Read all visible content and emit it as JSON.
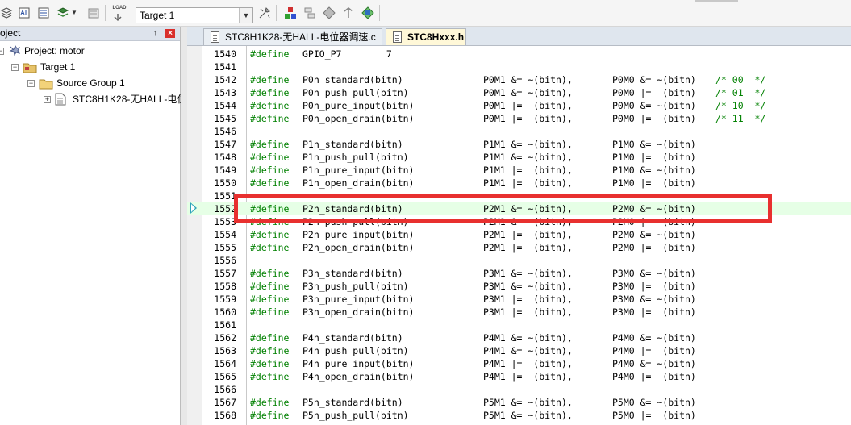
{
  "toolbar": {
    "target": "Target 1",
    "load_label": "LOAD"
  },
  "project_panel": {
    "title": "oject",
    "pin": "↑",
    "close": "×",
    "project": "Project: motor",
    "target": "Target 1",
    "group": "Source Group 1",
    "file": "STC8H1K28-无HALL-电位"
  },
  "tabs": [
    {
      "label": "STC8H1K28-无HALL-电位器调速.c",
      "active": false
    },
    {
      "label": "STC8Hxxx.h",
      "active": true
    }
  ],
  "editor": {
    "current_line": 1552,
    "lines": [
      {
        "n": "1540",
        "kw": "#define",
        "a": "GPIO_P7        7",
        "b": "",
        "c": "",
        "d": ""
      },
      {
        "n": "1541",
        "kw": "",
        "a": "",
        "b": "",
        "c": "",
        "d": ""
      },
      {
        "n": "1542",
        "kw": "#define",
        "a": "P0n_standard(bitn)",
        "b": "P0M1 &= ~(bitn),",
        "c": "P0M0 &= ~(bitn)",
        "d": "/* 00  */"
      },
      {
        "n": "1543",
        "kw": "#define",
        "a": "P0n_push_pull(bitn)",
        "b": "P0M1 &= ~(bitn),",
        "c": "P0M0 |=  (bitn)",
        "d": "/* 01  */"
      },
      {
        "n": "1544",
        "kw": "#define",
        "a": "P0n_pure_input(bitn)",
        "b": "P0M1 |=  (bitn),",
        "c": "P0M0 &= ~(bitn)",
        "d": "/* 10  */"
      },
      {
        "n": "1545",
        "kw": "#define",
        "a": "P0n_open_drain(bitn)",
        "b": "P0M1 |=  (bitn),",
        "c": "P0M0 |=  (bitn)",
        "d": "/* 11  */"
      },
      {
        "n": "1546",
        "kw": "",
        "a": "",
        "b": "",
        "c": "",
        "d": ""
      },
      {
        "n": "1547",
        "kw": "#define",
        "a": "P1n_standard(bitn)",
        "b": "P1M1 &= ~(bitn),",
        "c": "P1M0 &= ~(bitn)",
        "d": ""
      },
      {
        "n": "1548",
        "kw": "#define",
        "a": "P1n_push_pull(bitn)",
        "b": "P1M1 &= ~(bitn),",
        "c": "P1M0 |=  (bitn)",
        "d": ""
      },
      {
        "n": "1549",
        "kw": "#define",
        "a": "P1n_pure_input(bitn)",
        "b": "P1M1 |=  (bitn),",
        "c": "P1M0 &= ~(bitn)",
        "d": ""
      },
      {
        "n": "1550",
        "kw": "#define",
        "a": "P1n_open_drain(bitn)",
        "b": "P1M1 |=  (bitn),",
        "c": "P1M0 |=  (bitn)",
        "d": ""
      },
      {
        "n": "1551",
        "kw": "",
        "a": "",
        "b": "",
        "c": "",
        "d": ""
      },
      {
        "n": "1552",
        "kw": "#define",
        "a": "P2n_standard(bitn)",
        "b": "P2M1 &= ~(bitn),",
        "c": "P2M0 &= ~(bitn)",
        "d": ""
      },
      {
        "n": "1553",
        "kw": "#define",
        "a": "P2n_push_pull(bitn)",
        "b": "P2M1 &= ~(bitn),",
        "c": "P2M0 |=  (bitn)",
        "d": ""
      },
      {
        "n": "1554",
        "kw": "#define",
        "a": "P2n_pure_input(bitn)",
        "b": "P2M1 |=  (bitn),",
        "c": "P2M0 &= ~(bitn)",
        "d": ""
      },
      {
        "n": "1555",
        "kw": "#define",
        "a": "P2n_open_drain(bitn)",
        "b": "P2M1 |=  (bitn),",
        "c": "P2M0 |=  (bitn)",
        "d": ""
      },
      {
        "n": "1556",
        "kw": "",
        "a": "",
        "b": "",
        "c": "",
        "d": ""
      },
      {
        "n": "1557",
        "kw": "#define",
        "a": "P3n_standard(bitn)",
        "b": "P3M1 &= ~(bitn),",
        "c": "P3M0 &= ~(bitn)",
        "d": ""
      },
      {
        "n": "1558",
        "kw": "#define",
        "a": "P3n_push_pull(bitn)",
        "b": "P3M1 &= ~(bitn),",
        "c": "P3M0 |=  (bitn)",
        "d": ""
      },
      {
        "n": "1559",
        "kw": "#define",
        "a": "P3n_pure_input(bitn)",
        "b": "P3M1 |=  (bitn),",
        "c": "P3M0 &= ~(bitn)",
        "d": ""
      },
      {
        "n": "1560",
        "kw": "#define",
        "a": "P3n_open_drain(bitn)",
        "b": "P3M1 |=  (bitn),",
        "c": "P3M0 |=  (bitn)",
        "d": ""
      },
      {
        "n": "1561",
        "kw": "",
        "a": "",
        "b": "",
        "c": "",
        "d": ""
      },
      {
        "n": "1562",
        "kw": "#define",
        "a": "P4n_standard(bitn)",
        "b": "P4M1 &= ~(bitn),",
        "c": "P4M0 &= ~(bitn)",
        "d": ""
      },
      {
        "n": "1563",
        "kw": "#define",
        "a": "P4n_push_pull(bitn)",
        "b": "P4M1 &= ~(bitn),",
        "c": "P4M0 |=  (bitn)",
        "d": ""
      },
      {
        "n": "1564",
        "kw": "#define",
        "a": "P4n_pure_input(bitn)",
        "b": "P4M1 |=  (bitn),",
        "c": "P4M0 &= ~(bitn)",
        "d": ""
      },
      {
        "n": "1565",
        "kw": "#define",
        "a": "P4n_open_drain(bitn)",
        "b": "P4M1 |=  (bitn),",
        "c": "P4M0 |=  (bitn)",
        "d": ""
      },
      {
        "n": "1566",
        "kw": "",
        "a": "",
        "b": "",
        "c": "",
        "d": ""
      },
      {
        "n": "1567",
        "kw": "#define",
        "a": "P5n_standard(bitn)",
        "b": "P5M1 &= ~(bitn),",
        "c": "P5M0 &= ~(bitn)",
        "d": ""
      },
      {
        "n": "1568",
        "kw": "#define",
        "a": "P5n_push_pull(bitn)",
        "b": "P5M1 &= ~(bitn),",
        "c": "P5M0 |=  (bitn)",
        "d": ""
      }
    ]
  },
  "colors": {
    "keyword": "#008000",
    "comment": "#008000",
    "current_line_bg": "#e6ffe6",
    "annotation_box": "#e8302f",
    "exec_arrow": "#2fa4b8"
  }
}
